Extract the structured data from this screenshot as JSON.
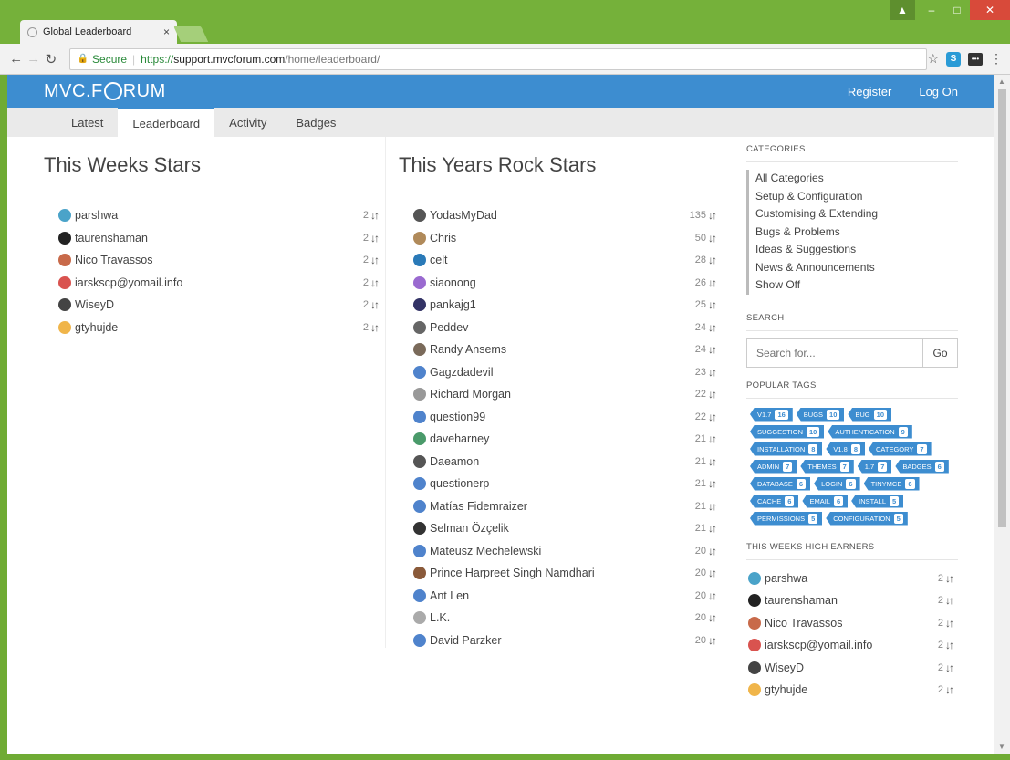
{
  "browser": {
    "tab_title": "Global Leaderboard",
    "tab_close": "×",
    "secure_label": "Secure",
    "url_https": "https://",
    "url_host": "support.mvcforum.com",
    "url_path": "/home/leaderboard/"
  },
  "site": {
    "logo_left": "MVC.F",
    "logo_right": "RUM",
    "register": "Register",
    "logon": "Log On",
    "accent": "#3d8dd0"
  },
  "nav": {
    "tabs": [
      "Latest",
      "Leaderboard",
      "Activity",
      "Badges"
    ],
    "active": "Leaderboard"
  },
  "weekly": {
    "title": "This Weeks Stars",
    "users": [
      {
        "name": "parshwa",
        "points": "2",
        "color": "#4aa3c9"
      },
      {
        "name": "taurenshaman",
        "points": "2",
        "color": "#222222"
      },
      {
        "name": "Nico Travassos",
        "points": "2",
        "color": "#c86a4a"
      },
      {
        "name": "iarskscp@yomail.info",
        "points": "2",
        "color": "#d9534f"
      },
      {
        "name": "WiseyD",
        "points": "2",
        "color": "#444444"
      },
      {
        "name": "gtyhujde",
        "points": "2",
        "color": "#f0b54a"
      }
    ]
  },
  "yearly": {
    "title": "This Years Rock Stars",
    "users": [
      {
        "name": "YodasMyDad",
        "points": "135",
        "color": "#555555"
      },
      {
        "name": "Chris",
        "points": "50",
        "color": "#b08a5a"
      },
      {
        "name": "celt",
        "points": "28",
        "color": "#2a7ab8"
      },
      {
        "name": "siaonong",
        "points": "26",
        "color": "#9a6ad0"
      },
      {
        "name": "pankajg1",
        "points": "25",
        "color": "#333366"
      },
      {
        "name": "Peddev",
        "points": "24",
        "color": "#666666"
      },
      {
        "name": "Randy Ansems",
        "points": "24",
        "color": "#7a6a5a"
      },
      {
        "name": "Gagzdadevil",
        "points": "23",
        "color": "#4f83cc"
      },
      {
        "name": "Richard Morgan",
        "points": "22",
        "color": "#999999"
      },
      {
        "name": "question99",
        "points": "22",
        "color": "#4f83cc"
      },
      {
        "name": "daveharney",
        "points": "21",
        "color": "#4a9a6a"
      },
      {
        "name": "Daeamon",
        "points": "21",
        "color": "#555555"
      },
      {
        "name": "questionerp",
        "points": "21",
        "color": "#4f83cc"
      },
      {
        "name": "Matías Fidemraizer",
        "points": "21",
        "color": "#4f83cc"
      },
      {
        "name": "Selman Özçelik",
        "points": "21",
        "color": "#333333"
      },
      {
        "name": "Mateusz Mechelewski",
        "points": "20",
        "color": "#4f83cc"
      },
      {
        "name": "Prince Harpreet Singh Namdhari",
        "points": "20",
        "color": "#8a5a3a"
      },
      {
        "name": "Ant Len",
        "points": "20",
        "color": "#4f83cc"
      },
      {
        "name": "L.K.",
        "points": "20",
        "color": "#aaaaaa"
      },
      {
        "name": "David Parzker",
        "points": "20",
        "color": "#4f83cc"
      }
    ]
  },
  "sidebar": {
    "categories_heading": "CATEGORIES",
    "categories": [
      "All Categories",
      "Setup & Configuration",
      "Customising & Extending",
      "Bugs & Problems",
      "Ideas & Suggestions",
      "News & Announcements",
      "Show Off"
    ],
    "search_heading": "SEARCH",
    "search_placeholder": "Search for...",
    "search_button": "Go",
    "tags_heading": "POPULAR TAGS",
    "tags": [
      {
        "name": "V1.7",
        "count": "16"
      },
      {
        "name": "BUGS",
        "count": "10"
      },
      {
        "name": "BUG",
        "count": "10"
      },
      {
        "name": "SUGGESTION",
        "count": "10"
      },
      {
        "name": "AUTHENTICATION",
        "count": "9"
      },
      {
        "name": "INSTALLATION",
        "count": "8"
      },
      {
        "name": "V1.8",
        "count": "8"
      },
      {
        "name": "CATEGORY",
        "count": "7"
      },
      {
        "name": "ADMIN",
        "count": "7"
      },
      {
        "name": "THEMES",
        "count": "7"
      },
      {
        "name": "1.7",
        "count": "7"
      },
      {
        "name": "BADGES",
        "count": "6"
      },
      {
        "name": "DATABASE",
        "count": "6"
      },
      {
        "name": "LOGIN",
        "count": "6"
      },
      {
        "name": "TINYMCE",
        "count": "6"
      },
      {
        "name": "CACHE",
        "count": "6"
      },
      {
        "name": "EMAIL",
        "count": "6"
      },
      {
        "name": "INSTALL",
        "count": "5"
      },
      {
        "name": "PERMISSIONS",
        "count": "5"
      },
      {
        "name": "CONFIGURATION",
        "count": "5"
      }
    ],
    "earners_heading": "THIS WEEKS HIGH EARNERS"
  }
}
